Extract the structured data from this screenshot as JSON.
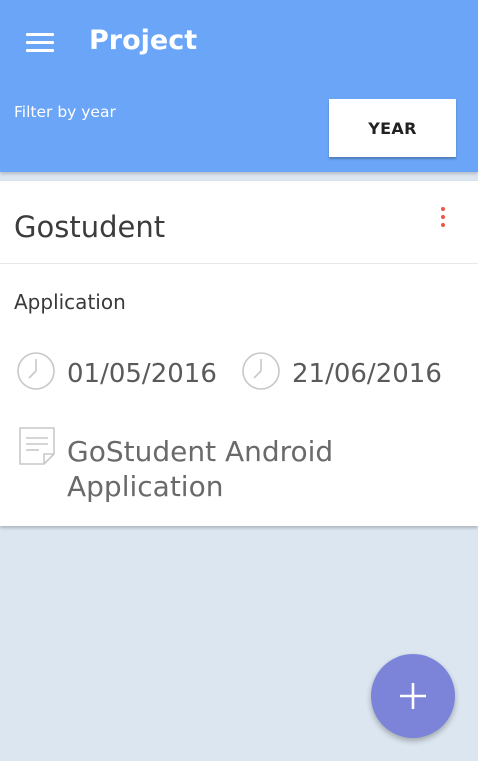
{
  "app": {
    "title": "Project"
  },
  "filter": {
    "label": "Filter by year",
    "button_label": "YEAR"
  },
  "project": {
    "name": "Gostudent",
    "category": "Application",
    "start_date": "01/05/2016",
    "end_date": "21/06/2016",
    "description": "GoStudent Android Application"
  },
  "icons": {
    "menu": "hamburger-menu-icon",
    "more": "more-vertical-icon",
    "start": "clock-icon",
    "end": "clock-icon",
    "description": "note-icon",
    "fab": "plus-icon"
  },
  "colors": {
    "appbar": "#6aa5f7",
    "background": "#dce6f0",
    "fab": "#7b84d9",
    "more_dots": "#f05545"
  }
}
